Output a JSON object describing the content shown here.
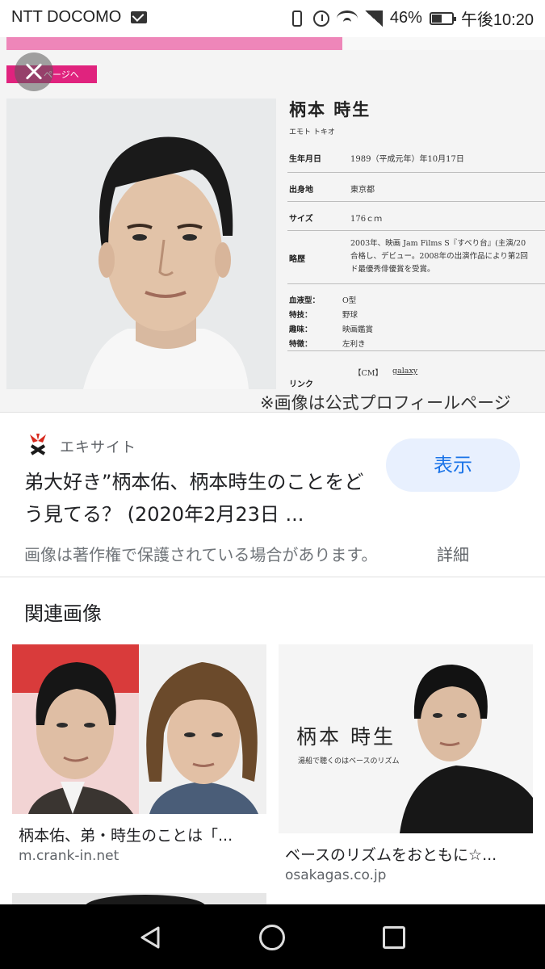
{
  "status_bar": {
    "carrier": "NTT DOCOMO",
    "battery": "46%",
    "time": "午後10:20"
  },
  "viewer": {
    "back_tab_label": "ページへ",
    "profile": {
      "name": "柄本 時生",
      "kana": "エモト トキオ",
      "rows": [
        {
          "label": "生年月日",
          "value": "1989（平成元年）年10月17日"
        },
        {
          "label": "出身地",
          "value": "東京都"
        },
        {
          "label": "サイズ",
          "value": "176ｃｍ"
        },
        {
          "label": "略歴",
          "value": ""
        }
      ],
      "career_lines": [
        "2003年、映画 Jam Films S『すべり台』(主演/20",
        "合格し、デビュー。2008年の出演作品により第2回",
        "ド最優秀俳優賞を受賞。"
      ],
      "details": [
        {
          "label": "血液型：",
          "value": "O型"
        },
        {
          "label": "特技：",
          "value": "野球"
        },
        {
          "label": "趣味：",
          "value": "映画鑑賞"
        },
        {
          "label": "特徴：",
          "value": "左利き"
        }
      ],
      "link_label": "リンク",
      "cm_label": "【CM】",
      "cm_link": "galaxy"
    },
    "caption": "※画像は公式プロフィールページ"
  },
  "info": {
    "source": "エキサイト",
    "title": "弟大好き”柄本佑、柄本時生のことをどう見てる？ (2020年2月23日 ...",
    "view_button": "表示",
    "copyright_note": "画像は著作権で保護されている場合があります。",
    "details_link": "詳細"
  },
  "related": {
    "heading": "関連画像",
    "cards": [
      {
        "title": "柄本佑、弟・時生のことは「...",
        "source": "m.crank-in.net"
      },
      {
        "title": "ベースのリズムをおともに☆...",
        "source": "osakagas.co.jp",
        "poster_name": "柄本 時生",
        "poster_sub": "湯船で聴くのはベースのリズム"
      }
    ]
  }
}
